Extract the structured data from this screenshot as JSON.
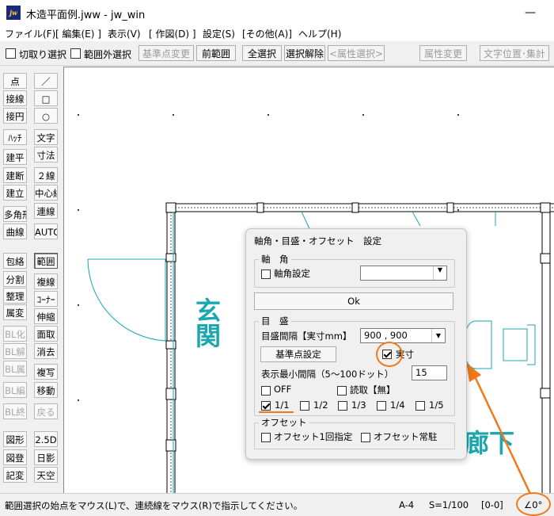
{
  "window": {
    "title": "木造平面例.jww - jw_win",
    "icon_text": "jw",
    "minimize": "—"
  },
  "menu": [
    "ファイル(F)",
    "[ 編集(E) ]",
    "表示(V)",
    "[ 作図(D) ]",
    "設定(S)",
    "[その他(A)]",
    "ヘルプ(H)"
  ],
  "toolbar": {
    "cut_select": "切取り選択",
    "outside_select": "範囲外選択",
    "base_change": "基準点変更",
    "prev_range": "前範囲",
    "select_all": "全選択",
    "deselect": "選択解除",
    "attr_select": "<属性選択>",
    "attr_change": "属性変更",
    "text_pos": "文字位置･集計"
  },
  "palette": {
    "left": [
      "点",
      "接線",
      "接円",
      "ﾊｯﾁ",
      "建平",
      "建断",
      "建立",
      "多角形",
      "曲線",
      "包絡",
      "分割",
      "整理",
      "属変",
      "BL化",
      "BL解",
      "BL属",
      "BL編",
      "BL終",
      "図形",
      "図登",
      "記変"
    ],
    "right": [
      "／",
      "□",
      "○",
      "文字",
      "寸法",
      "２線",
      "中心線",
      "連線",
      "AUTO",
      "範囲",
      "複線",
      "ｺｰﾅｰ",
      "伸縮",
      "面取",
      "消去",
      "複写",
      "移動",
      "戻る",
      "2.5D",
      "日影",
      "天空"
    ]
  },
  "drawing": {
    "label_entrance": "玄関",
    "label_corridor": "廊下"
  },
  "dialog": {
    "title": "軸角・目盛・オフセット　設定",
    "axis_group": "軸　角",
    "axis_setting": "軸角設定",
    "ok": "Ok",
    "scale_group": "目　盛",
    "scale_interval_label": "目盛間隔【実寸mm】",
    "scale_interval_value": "900 , 900",
    "base_point_button": "基準点設定",
    "actual_size": "実寸",
    "min_interval_label": "表示最小間隔（5～100ドット）",
    "min_interval_value": "15",
    "off": "OFF",
    "read_none": "読取【無】",
    "ratios": [
      "1/1",
      "1/2",
      "1/3",
      "1/4",
      "1/5"
    ],
    "offset_group": "オフセット",
    "offset_once": "オフセット1回指定",
    "offset_always": "オフセット常駐"
  },
  "status": {
    "message": "範囲選択の始点をマウス(L)で、連続線をマウス(R)で指示してください。",
    "paper": "A-4",
    "scale": "S=1/100",
    "layer": "[0-0]",
    "angle": "∠0°"
  },
  "colors": {
    "accent_orange": "#f07a1a",
    "cad_cyan": "#1aa7b0"
  }
}
